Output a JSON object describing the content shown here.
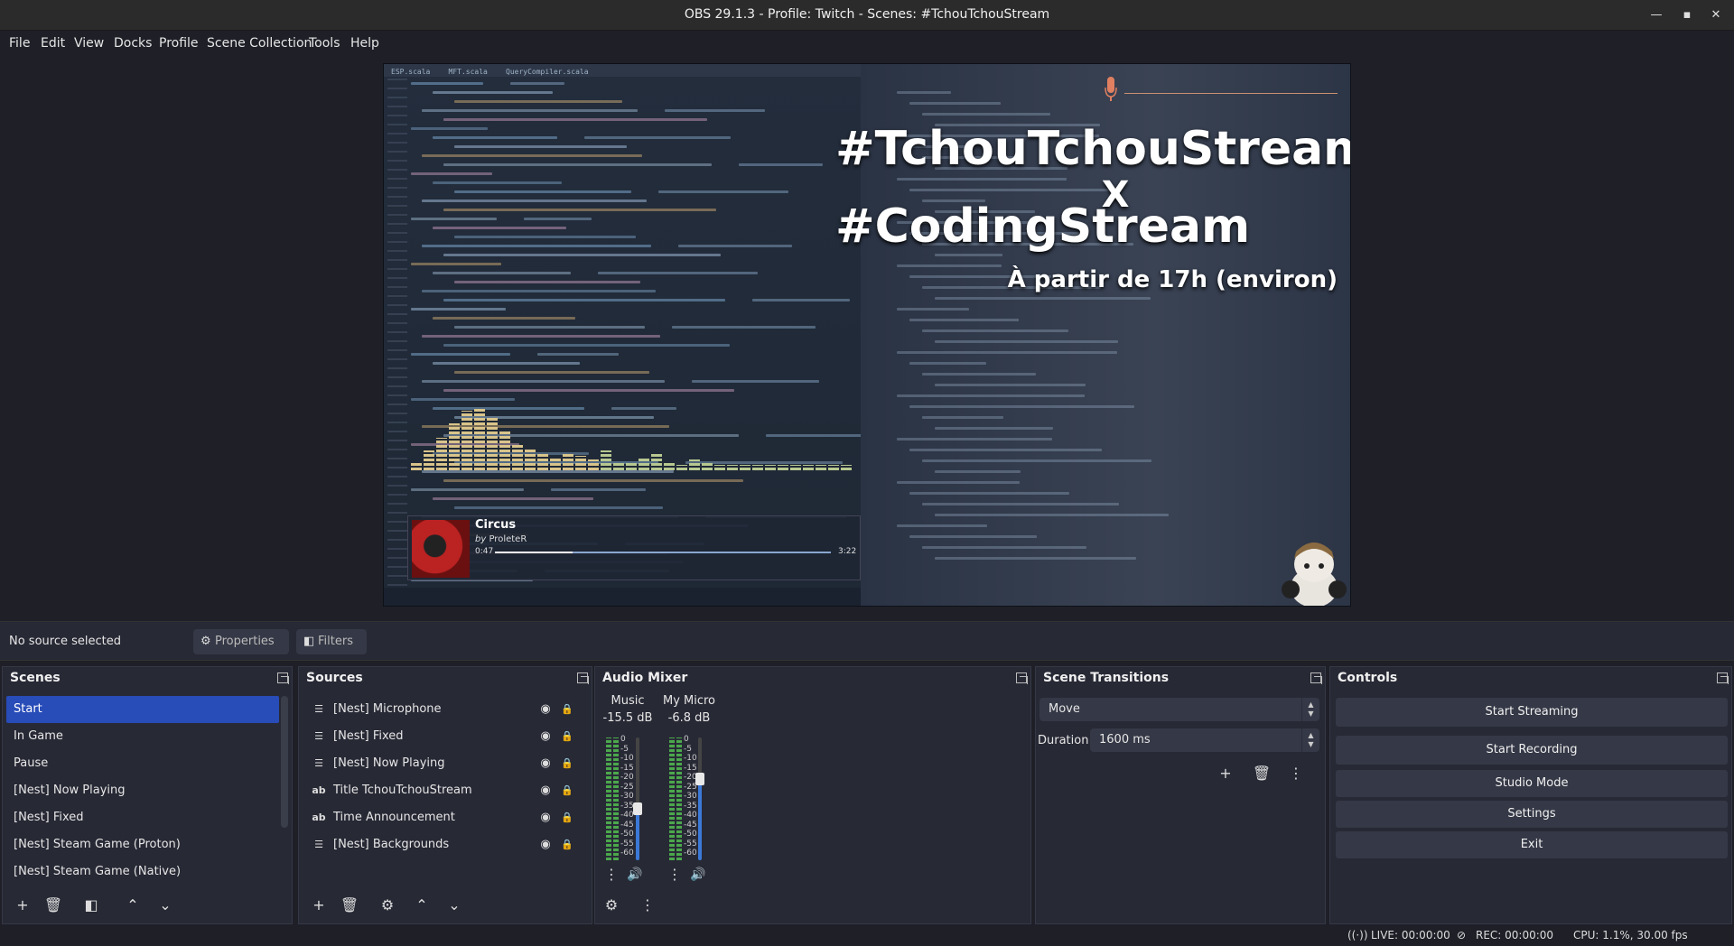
{
  "window": {
    "title": "OBS 29.1.3 - Profile: Twitch - Scenes: #TchouTchouStream",
    "minimize_icon": "minimize-icon",
    "maximize_icon": "maximize-icon",
    "close_icon": "close-icon"
  },
  "menu": [
    "File",
    "Edit",
    "View",
    "Docks",
    "Profile",
    "Scene Collection",
    "Tools",
    "Help"
  ],
  "preview": {
    "editor_tabs": [
      "ESP.scala",
      "MFT.scala",
      "QueryCompiler.scala"
    ],
    "overlay_title_1": "#TchouTchouStream",
    "overlay_x": "X",
    "overlay_title_2": "#CodingStream",
    "overlay_subtitle": "À partir de 17h (environ)",
    "now_playing": {
      "title": "Circus",
      "by": "by",
      "artist": "ProleteR",
      "current": "0:47",
      "total": "3:22",
      "progress": 0.23
    }
  },
  "source_toolbar": {
    "status": "No source selected",
    "properties_label": "Properties",
    "filters_label": "Filters"
  },
  "scenes": {
    "title": "Scenes",
    "items": [
      "Start",
      "In Game",
      "Pause",
      "[Nest] Now Playing",
      "[Nest] Fixed",
      "[Nest] Steam Game (Proton)",
      "[Nest] Steam Game (Native)"
    ],
    "selected_index": 0
  },
  "sources": {
    "title": "Sources",
    "items": [
      {
        "label": "[Nest] Microphone",
        "icon": "list-icon",
        "glyph": "☰"
      },
      {
        "label": "[Nest] Fixed",
        "icon": "list-icon",
        "glyph": "☰"
      },
      {
        "label": "[Nest] Now Playing",
        "icon": "list-icon",
        "glyph": "☰"
      },
      {
        "label": "Title TchouTchouStream",
        "icon": "text-icon",
        "glyph": "ab"
      },
      {
        "label": "Time Announcement",
        "icon": "text-icon",
        "glyph": "ab"
      },
      {
        "label": "[Nest] Backgrounds",
        "icon": "list-icon",
        "glyph": "☰"
      }
    ]
  },
  "audio_mixer": {
    "title": "Audio Mixer",
    "channels": [
      {
        "name": "Music",
        "db": "-15.5 dB",
        "volume": 0.42
      },
      {
        "name": "My Micro",
        "db": "-6.8 dB",
        "volume": 0.66
      }
    ],
    "ticks": [
      "0",
      "-5",
      "-10",
      "-15",
      "-20",
      "-25",
      "-30",
      "-35",
      "-40",
      "-45",
      "-50",
      "-55",
      "-60"
    ]
  },
  "transitions": {
    "title": "Scene Transitions",
    "selected": "Move",
    "duration_label": "Duration",
    "duration_value": "1600 ms"
  },
  "controls": {
    "title": "Controls",
    "buttons": [
      "Start Streaming",
      "Start Recording",
      "Studio Mode",
      "Settings",
      "Exit"
    ]
  },
  "statusbar": {
    "live": "LIVE: 00:00:00",
    "rec": "REC: 00:00:00",
    "cpu": "CPU: 1.1%, 30.00 fps"
  }
}
